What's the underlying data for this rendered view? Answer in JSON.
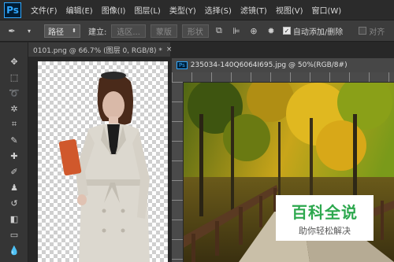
{
  "app": {
    "logo": "Ps"
  },
  "menu": [
    "文件(F)",
    "编辑(E)",
    "图像(I)",
    "图层(L)",
    "类型(Y)",
    "选择(S)",
    "滤镜(T)",
    "视图(V)",
    "窗口(W)"
  ],
  "options": {
    "mode_value": "路径",
    "build_label": "建立:",
    "selection_btn": "选区...",
    "mask_btn": "蒙版",
    "shape_btn": "形状",
    "auto_add_delete": "自动添加/删除",
    "align_edges": "对齐"
  },
  "tools": [
    "move-icon",
    "marquee-icon",
    "lasso-icon",
    "magic-wand-icon",
    "crop-icon",
    "eyedropper-icon",
    "healing-icon",
    "brush-icon",
    "stamp-icon",
    "history-brush-icon",
    "eraser-icon",
    "gradient-icon",
    "blur-icon"
  ],
  "tabs": {
    "doc1": "0101.png @ 66.7% (图层 0, RGB/8) *",
    "doc2": "235034-140Q6064I695.jpg @ 50%(RGB/8#)"
  },
  "watermark": {
    "title": "百科全说",
    "subtitle": "助你轻松解决"
  }
}
